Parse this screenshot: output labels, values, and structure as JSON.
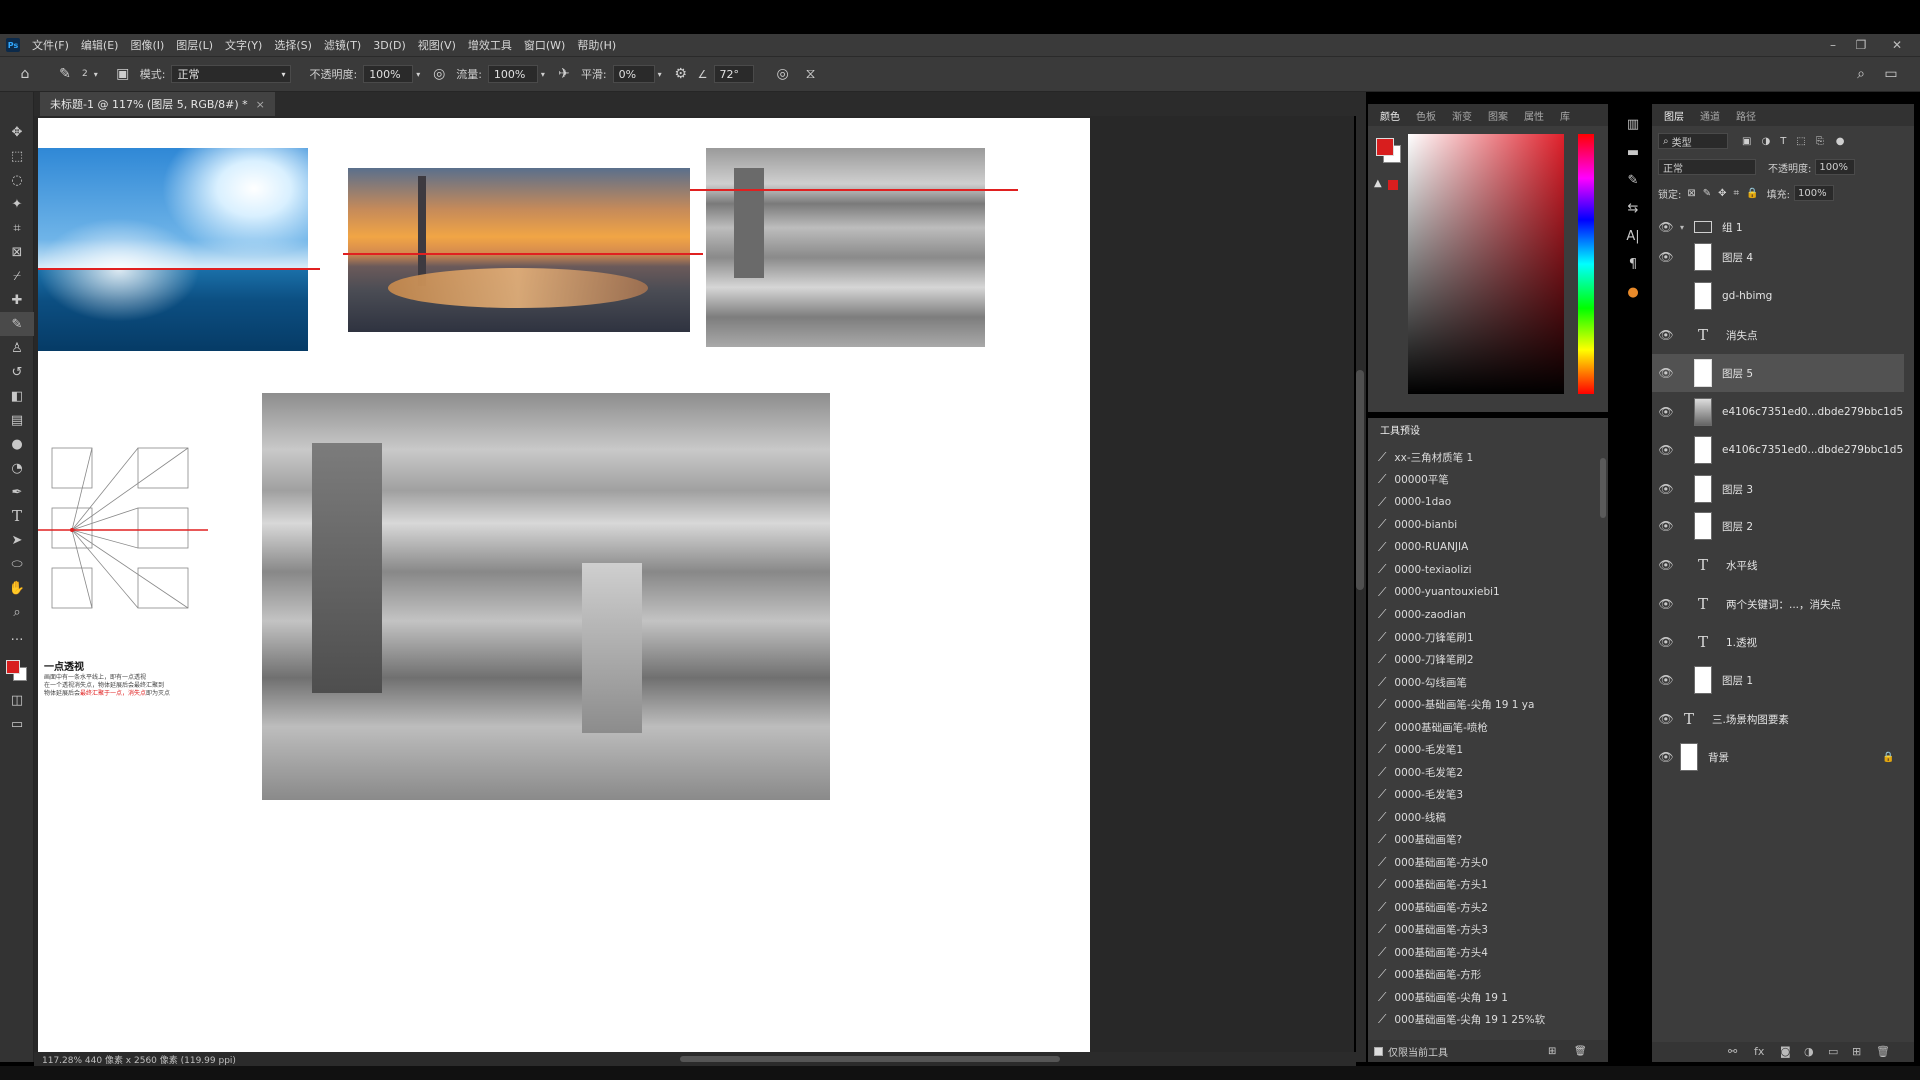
{
  "app": {
    "logo": "Ps"
  },
  "menu": [
    "文件(F)",
    "编辑(E)",
    "图像(I)",
    "图层(L)",
    "文字(Y)",
    "选择(S)",
    "滤镜(T)",
    "3D(D)",
    "视图(V)",
    "增效工具",
    "窗口(W)",
    "帮助(H)"
  ],
  "options": {
    "mode_label": "模式:",
    "mode_value": "正常",
    "opacity_label": "不透明度:",
    "opacity_value": "100%",
    "flow_label": "流量:",
    "flow_value": "100%",
    "smooth_label": "平滑:",
    "smooth_value": "0%",
    "angle_value": "72°",
    "brush_size": "2"
  },
  "document": {
    "tab_title": "未标题-1 @ 117% (图层 5, RGB/8#) *",
    "status": "117.28%   440 像素 x 2560 像素 (119.99 ppi)"
  },
  "canvas_text": {
    "diagram_title": "一点透视",
    "diagram_note1": "画面中有一条水平线上，即有一点透视",
    "diagram_note2": "在一个透视消失点，物体延展后会最终汇聚到",
    "diagram_note3_black": "物体延展后会",
    "diagram_note3_red": "最终汇聚于一点，消失点",
    "diagram_note3_end": "即为灭点"
  },
  "color_panel": {
    "tabs": [
      "颜色",
      "色板",
      "渐变",
      "图案",
      "属性",
      "库"
    ],
    "foreground": "#d81e1e",
    "background": "#ffffff"
  },
  "presets_panel": {
    "title": "工具预设",
    "items": [
      "xx-三角材质笔 1",
      "00000平笔",
      "0000-1dao",
      "0000-bianbi",
      "0000-RUANJIA",
      "0000-texiaolizi",
      "0000-yuantouxiebi1",
      "0000-zaodian",
      "0000-刀锋笔刷1",
      "0000-刀锋笔刷2",
      "0000-勾线画笔",
      "0000-基础画笔-尖角 19 1 ya",
      "0000基础画笔-喷枪",
      "0000-毛发笔1",
      "0000-毛发笔2",
      "0000-毛发笔3",
      "0000-线稿",
      "000基础画笔?",
      "000基础画笔-方头0",
      "000基础画笔-方头1",
      "000基础画笔-方头2",
      "000基础画笔-方头3",
      "000基础画笔-方头4",
      "000基础画笔-方形",
      "000基础画笔-尖角 19 1",
      "000基础画笔-尖角 19 1 25%软"
    ],
    "footer_label": "仅限当前工具"
  },
  "layers_panel": {
    "tabs": [
      "图层",
      "通道",
      "路径"
    ],
    "filter_label": "类型",
    "blend_mode": "正常",
    "opacity_label": "不透明度:",
    "opacity_value": "100%",
    "lock_label": "锁定:",
    "fill_label": "填充:",
    "fill_value": "100%",
    "layers": [
      {
        "name": "组 1",
        "kind": "group",
        "visible": true
      },
      {
        "name": "图层 4",
        "kind": "pixel",
        "visible": true
      },
      {
        "name": "gd-hbimg",
        "kind": "pixel",
        "visible": false
      },
      {
        "name": "消失点",
        "kind": "text",
        "visible": true
      },
      {
        "name": "图层 5",
        "kind": "pixel",
        "visible": true,
        "selected": true
      },
      {
        "name": "e4106c7351ed0...dbde279bbc1d5",
        "kind": "image",
        "visible": true
      },
      {
        "name": "e4106c7351ed0...dbde279bbc1d5",
        "kind": "pixel",
        "visible": true
      },
      {
        "name": "图层 3",
        "kind": "pixel",
        "visible": true
      },
      {
        "name": "图层 2",
        "kind": "pixel",
        "visible": true
      },
      {
        "name": "水平线",
        "kind": "text",
        "visible": true
      },
      {
        "name": "两个关键词：...，消失点",
        "kind": "text",
        "visible": true
      },
      {
        "name": "1.透视",
        "kind": "text",
        "visible": true
      },
      {
        "name": "图层 1",
        "kind": "pixel",
        "visible": true
      },
      {
        "name": "三.场景构图要素",
        "kind": "text-root",
        "visible": true
      },
      {
        "name": "背景",
        "kind": "background",
        "visible": true,
        "locked": true
      }
    ]
  }
}
